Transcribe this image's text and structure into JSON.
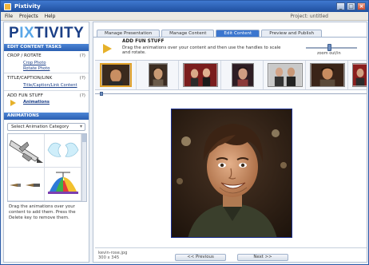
{
  "window": {
    "title": "Pixtivity",
    "minimize": "_",
    "maximize": "□",
    "close": "×"
  },
  "menu": {
    "items": [
      "File",
      "Projects",
      "Help"
    ],
    "project": "Project: untitled"
  },
  "logo": {
    "text_a": "P",
    "text_b": "IX",
    "text_c": "TIVITY"
  },
  "sidebar": {
    "tasks_header": "EDIT CONTENT TASKS",
    "sections": [
      {
        "title": "CROP / ROTATE",
        "help": "(?)",
        "links": [
          "Crop Photo",
          "Rotate Photo"
        ]
      },
      {
        "title": "TITLE/CAPTION/LINK",
        "help": "(?)",
        "links": [
          "Title/Caption/Link Content"
        ]
      },
      {
        "title": "ADD FUN STUFF",
        "help": "(?)",
        "links": [
          "Animations"
        ]
      }
    ],
    "animations_header": "ANIMATIONS",
    "category_placeholder": "Select Animation Category",
    "help_text": "Drag the animations over your content to add them. Press the Delete key to remove them."
  },
  "tabs": [
    "Manage Presentation",
    "Manage Content",
    "Edit Content",
    "Preview and Publish"
  ],
  "active_tab": 2,
  "instructions": {
    "title": "ADD FUN STUFF",
    "body": "Drag the animations over your content and then use the handles to scale and rotate."
  },
  "zoom": {
    "label": "zoom out/in",
    "level": 0.45
  },
  "strip": {
    "selected_index": 0,
    "thumb_count": 8
  },
  "file": {
    "name": "kevin-rose.jpg",
    "size": "300 x 345"
  },
  "nav": {
    "previous": "<< Previous",
    "next": "Next >>"
  },
  "colors": {
    "accent": "#3b76cf",
    "highlight": "#e6b12a",
    "photo_border": "#1b2f8f"
  }
}
